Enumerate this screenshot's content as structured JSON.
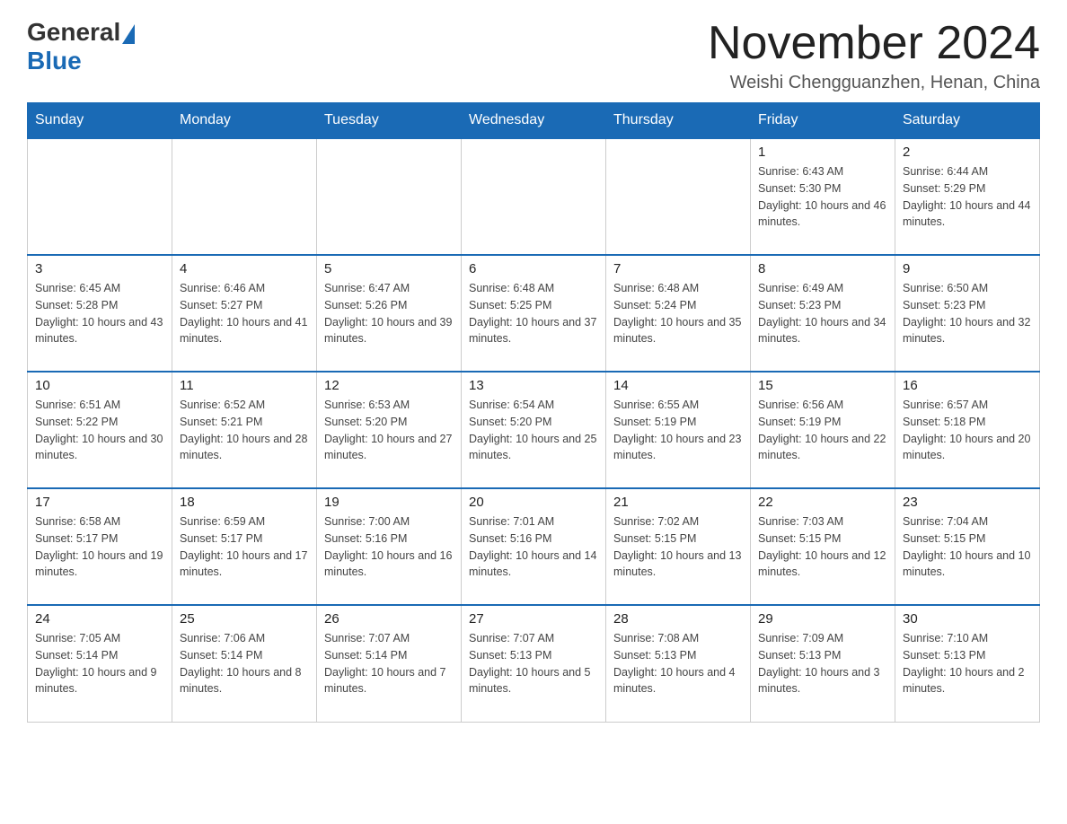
{
  "header": {
    "logo_general": "General",
    "logo_blue": "Blue",
    "month_title": "November 2024",
    "location": "Weishi Chengguanzhen, Henan, China"
  },
  "days_of_week": [
    "Sunday",
    "Monday",
    "Tuesday",
    "Wednesday",
    "Thursday",
    "Friday",
    "Saturday"
  ],
  "weeks": [
    {
      "days": [
        {
          "num": "",
          "info": ""
        },
        {
          "num": "",
          "info": ""
        },
        {
          "num": "",
          "info": ""
        },
        {
          "num": "",
          "info": ""
        },
        {
          "num": "",
          "info": ""
        },
        {
          "num": "1",
          "info": "Sunrise: 6:43 AM\nSunset: 5:30 PM\nDaylight: 10 hours and 46 minutes."
        },
        {
          "num": "2",
          "info": "Sunrise: 6:44 AM\nSunset: 5:29 PM\nDaylight: 10 hours and 44 minutes."
        }
      ]
    },
    {
      "days": [
        {
          "num": "3",
          "info": "Sunrise: 6:45 AM\nSunset: 5:28 PM\nDaylight: 10 hours and 43 minutes."
        },
        {
          "num": "4",
          "info": "Sunrise: 6:46 AM\nSunset: 5:27 PM\nDaylight: 10 hours and 41 minutes."
        },
        {
          "num": "5",
          "info": "Sunrise: 6:47 AM\nSunset: 5:26 PM\nDaylight: 10 hours and 39 minutes."
        },
        {
          "num": "6",
          "info": "Sunrise: 6:48 AM\nSunset: 5:25 PM\nDaylight: 10 hours and 37 minutes."
        },
        {
          "num": "7",
          "info": "Sunrise: 6:48 AM\nSunset: 5:24 PM\nDaylight: 10 hours and 35 minutes."
        },
        {
          "num": "8",
          "info": "Sunrise: 6:49 AM\nSunset: 5:23 PM\nDaylight: 10 hours and 34 minutes."
        },
        {
          "num": "9",
          "info": "Sunrise: 6:50 AM\nSunset: 5:23 PM\nDaylight: 10 hours and 32 minutes."
        }
      ]
    },
    {
      "days": [
        {
          "num": "10",
          "info": "Sunrise: 6:51 AM\nSunset: 5:22 PM\nDaylight: 10 hours and 30 minutes."
        },
        {
          "num": "11",
          "info": "Sunrise: 6:52 AM\nSunset: 5:21 PM\nDaylight: 10 hours and 28 minutes."
        },
        {
          "num": "12",
          "info": "Sunrise: 6:53 AM\nSunset: 5:20 PM\nDaylight: 10 hours and 27 minutes."
        },
        {
          "num": "13",
          "info": "Sunrise: 6:54 AM\nSunset: 5:20 PM\nDaylight: 10 hours and 25 minutes."
        },
        {
          "num": "14",
          "info": "Sunrise: 6:55 AM\nSunset: 5:19 PM\nDaylight: 10 hours and 23 minutes."
        },
        {
          "num": "15",
          "info": "Sunrise: 6:56 AM\nSunset: 5:19 PM\nDaylight: 10 hours and 22 minutes."
        },
        {
          "num": "16",
          "info": "Sunrise: 6:57 AM\nSunset: 5:18 PM\nDaylight: 10 hours and 20 minutes."
        }
      ]
    },
    {
      "days": [
        {
          "num": "17",
          "info": "Sunrise: 6:58 AM\nSunset: 5:17 PM\nDaylight: 10 hours and 19 minutes."
        },
        {
          "num": "18",
          "info": "Sunrise: 6:59 AM\nSunset: 5:17 PM\nDaylight: 10 hours and 17 minutes."
        },
        {
          "num": "19",
          "info": "Sunrise: 7:00 AM\nSunset: 5:16 PM\nDaylight: 10 hours and 16 minutes."
        },
        {
          "num": "20",
          "info": "Sunrise: 7:01 AM\nSunset: 5:16 PM\nDaylight: 10 hours and 14 minutes."
        },
        {
          "num": "21",
          "info": "Sunrise: 7:02 AM\nSunset: 5:15 PM\nDaylight: 10 hours and 13 minutes."
        },
        {
          "num": "22",
          "info": "Sunrise: 7:03 AM\nSunset: 5:15 PM\nDaylight: 10 hours and 12 minutes."
        },
        {
          "num": "23",
          "info": "Sunrise: 7:04 AM\nSunset: 5:15 PM\nDaylight: 10 hours and 10 minutes."
        }
      ]
    },
    {
      "days": [
        {
          "num": "24",
          "info": "Sunrise: 7:05 AM\nSunset: 5:14 PM\nDaylight: 10 hours and 9 minutes."
        },
        {
          "num": "25",
          "info": "Sunrise: 7:06 AM\nSunset: 5:14 PM\nDaylight: 10 hours and 8 minutes."
        },
        {
          "num": "26",
          "info": "Sunrise: 7:07 AM\nSunset: 5:14 PM\nDaylight: 10 hours and 7 minutes."
        },
        {
          "num": "27",
          "info": "Sunrise: 7:07 AM\nSunset: 5:13 PM\nDaylight: 10 hours and 5 minutes."
        },
        {
          "num": "28",
          "info": "Sunrise: 7:08 AM\nSunset: 5:13 PM\nDaylight: 10 hours and 4 minutes."
        },
        {
          "num": "29",
          "info": "Sunrise: 7:09 AM\nSunset: 5:13 PM\nDaylight: 10 hours and 3 minutes."
        },
        {
          "num": "30",
          "info": "Sunrise: 7:10 AM\nSunset: 5:13 PM\nDaylight: 10 hours and 2 minutes."
        }
      ]
    }
  ]
}
